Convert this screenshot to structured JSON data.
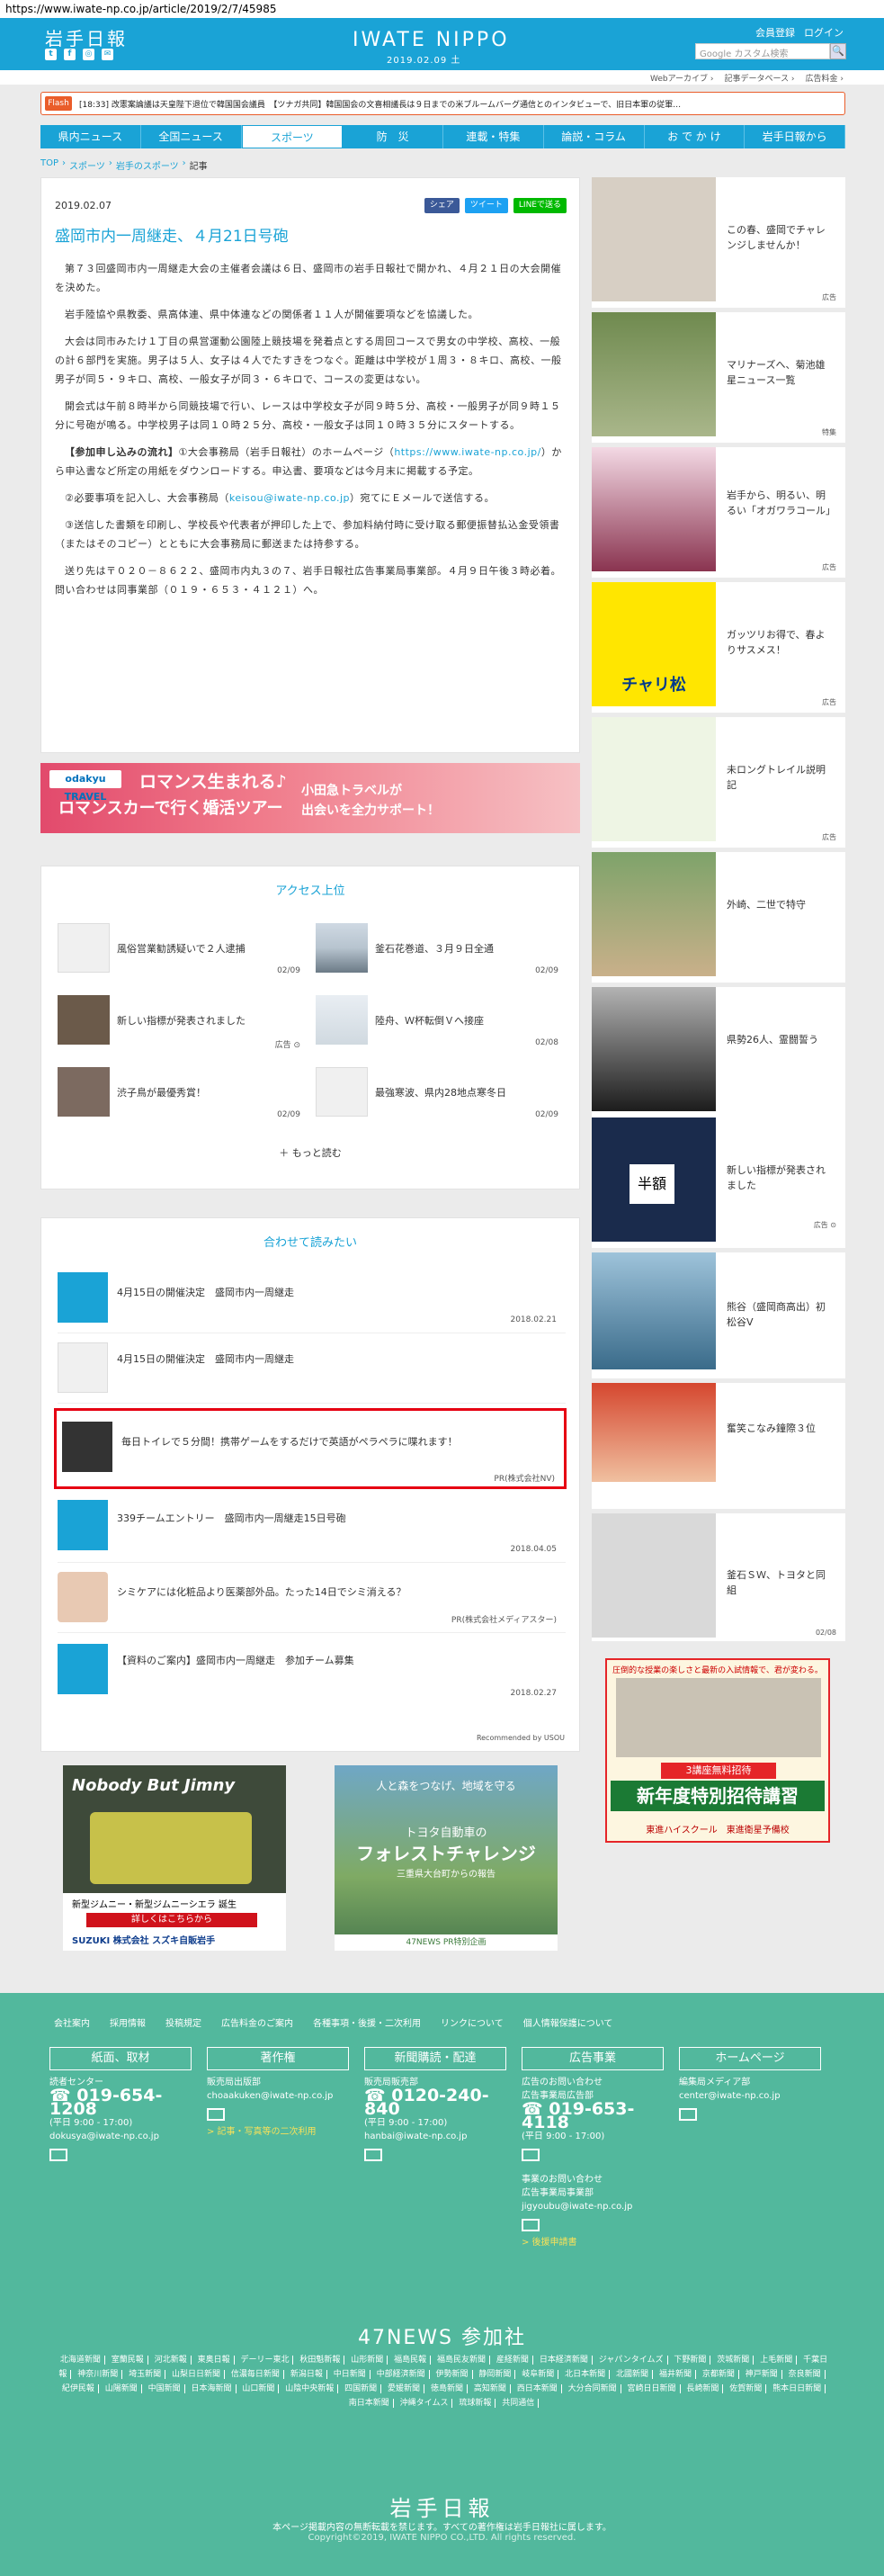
{
  "url": "https://www.iwate-np.co.jp/article/2019/2/7/45985",
  "header": {
    "logo_jp": "岩手日報",
    "logo_en": "IWATE NIPPO",
    "date": "2019.02.09 土",
    "member_register": "会員登録",
    "login": "ログイン",
    "search_placeholder": "Google カスタム検索",
    "search_button": "🔍",
    "social": [
      "twitter-icon",
      "facebook-icon",
      "instagram-icon",
      "mail-icon"
    ]
  },
  "subnav": [
    "Webアーカイブ ›",
    "記事データベース ›",
    "広告料金 ›"
  ],
  "flash": {
    "label": "Flash",
    "text": "[18:33] 改憲案論議は天皇陛下退位で韓国国会議員　【ツナガ共同】韓国国会の文喜相議長は９日までの米ブルームバーグ通信とのインタビューで、旧日本軍の従軍…"
  },
  "gnav": [
    "県内ニュース",
    "全国ニュース",
    "スポーツ",
    "防　災",
    "連載・特集",
    "論説・コラム",
    "お で か け",
    "岩手日報から"
  ],
  "gnav_active": 2,
  "breadcrumb": [
    "TOP",
    "スポーツ",
    "岩手のスポーツ",
    "記事"
  ],
  "article": {
    "date": "2019.02.07",
    "title": "盛岡市内一周継走、４月21日号砲",
    "share_facebook": "シェア",
    "share_twitter": "ツイート",
    "share_line": "LINEで送る",
    "p1": "第７３回盛岡市内一周継走大会の主催者会議は６日、盛岡市の岩手日報社で開かれ、４月２１日の大会開催を決めた。",
    "p2": "岩手陸協や県教委、県高体連、県中体連などの関係者１１人が開催要項などを協議した。",
    "p3": "大会は同市みたけ１丁目の県営運動公園陸上競技場を発着点とする周回コースで男女の中学校、高校、一般の計６部門を実施。男子は５人、女子は４人でたすきをつなぐ。距離は中学校が１周３・８キロ、高校、一般男子が同５・９キロ、高校、一般女子が同３・６キロで、コースの変更はない。",
    "p4": "開会式は午前８時半から同競技場で行い、レースは中学校女子が同９時５分、高校・一般男子が同９時１５分に号砲が鳴る。中学校男子は同１０時２５分、高校・一般女子は同１０時３５分にスタートする。",
    "p5_label": "【参加申し込みの流れ】",
    "p5_text": "①大会事務局（岩手日報社）のホームページ（",
    "p5_url": "https://www.iwate-np.co.jp/",
    "p5_rest": "）から申込書など所定の用紙をダウンロードする。申込書、要項などは今月末に掲載する予定。",
    "p6_pre": "②必要事項を記入し、大会事務局（",
    "p6_mail": "keisou@iwate-np.co.jp",
    "p6_post": "）宛てにＥメールで送信する。",
    "p7": "③送信した書類を印刷し、学校長や代表者が押印した上で、参加料納付時に受け取る郵便振替払込金受領書（またはそのコピー）とともに大会事務局に郵送または持参する。",
    "p8": "送り先は〒０２０－８６２２、盛岡市内丸３の７、岩手日報社広告事業局事業部。４月９日午後３時必着。問い合わせは同事業部（０１９・６５３・４１２１）へ。"
  },
  "ad_odakyu": {
    "brand": "odakyu TRAVEL",
    "line1": "ロマンス生まれる♪",
    "line2": "ロマンスカーで行く婚活ツアー",
    "line3": "小田急トラベルが\n出会いを全力サポート！"
  },
  "access": {
    "title": "アクセス上位",
    "items": [
      {
        "text": "風俗営業勧誘疑いで２人逮捕",
        "date": "02/09"
      },
      {
        "text": "釜石花巻道、３月９日全通",
        "date": "02/09"
      },
      {
        "text": "新しい指標が発表されました",
        "date": "広告 ⊙"
      },
      {
        "text": "陸舟、Ｗ杯転倒Ｖへ接座",
        "date": "02/08"
      },
      {
        "text": "渋子鳥が最優秀賞！",
        "date": "02/09"
      },
      {
        "text": "最強寒波、県内28地点寒冬日",
        "date": "02/09"
      }
    ],
    "more": "もっと読む"
  },
  "related": {
    "title": "合わせて読みたい",
    "items": [
      {
        "text": "4月15日の開催決定　盛岡市内一周継走",
        "meta": "2018.02.21"
      },
      {
        "text": "4月15日の開催決定　盛岡市内一周継走",
        "meta": ""
      },
      {
        "text": "毎日トイレで５分間！携帯ゲームをするだけで英語がペラペラに喋れます！",
        "meta": "PR(株式会社NV)"
      },
      {
        "text": "339チームエントリー　盛岡市内一周継走15日号砲",
        "meta": "2018.04.05"
      },
      {
        "text": "シミケアには化粧品より医薬部外品。たった14日でシミ消える？",
        "meta": "PR(株式会社メディアスター)"
      },
      {
        "text": "【資料のご案内】盛岡市内一周継走　参加チーム募集",
        "meta": "2018.02.27"
      }
    ],
    "recommended": "Recommended by USOU"
  },
  "side": [
    {
      "text": "この春、盛岡でチャレンジしませんか！",
      "note": "広告"
    },
    {
      "text": "マリナーズへ、菊池雄星ニュース一覧",
      "note": "特集"
    },
    {
      "text": "岩手から、明るい、明るい「オガワラコール」",
      "note": "広告"
    },
    {
      "text": "ガッツリお得で、春よりサスメス！",
      "note": "広告"
    },
    {
      "text": "未ロングトレイル説明記",
      "note": "広告"
    },
    {
      "text": "外崎、二世で特守",
      "note": ""
    },
    {
      "text": "県勢26人、霊闘誓う",
      "note": ""
    },
    {
      "text": "新しい指標が発表されました",
      "note": "広告 ⊙"
    },
    {
      "text": "熊谷（盛岡商高出）初松谷V",
      "note": ""
    },
    {
      "text": "奮笑こなみ鐘際３位",
      "note": ""
    },
    {
      "text": "釜石ＳＷ、トヨタと同組",
      "note": "02/08"
    }
  ],
  "side_ad_cycle": "チャリ松",
  "ad_jimny": {
    "title": "Nobody But Jimny",
    "sub": "新型ジムニー・新型ジムニーシエラ 誕生",
    "cta": "詳しくはこちらから",
    "maker": "SUZUKI 株式会社 スズキ自販岩手"
  },
  "ad_toyota": {
    "line1": "人と森をつなげ、地域を守る",
    "line2": "トヨタ自動車の",
    "line3": "フォレストチャレンジ",
    "line4": "三重県大台町からの報告",
    "footer": "47NEWS PR特別企画"
  },
  "ad_school": {
    "top": "圧倒的な授業の楽しさと最新の入試情報で、君が変わる。",
    "badge": "3講座無料招待",
    "title": "新年度特別招待講習",
    "sub": "東進ハイスクール　東進衛星予備校"
  },
  "footer": {
    "links": [
      "会社案内",
      "採用情報",
      "投稿規定",
      "広告料金のご案内",
      "各種事項・後援・二次利用",
      "リンクについて",
      "個人情報保護について"
    ],
    "cols": [
      {
        "head": "紙面、取材",
        "l1": "読者センター",
        "tel": "019-654-1208",
        "hours": "(平日 9:00 - 17:00)",
        "mail": "dokusya@iwate-np.co.jp",
        "extra": ""
      },
      {
        "head": "著作権",
        "l1": "販売局出版部",
        "tel": "",
        "hours": "",
        "mail": "choaakuken@iwate-np.co.jp",
        "extra": "> 記事・写真等の二次利用"
      },
      {
        "head": "新聞購読・配達",
        "l1": "販売局販売部",
        "tel": "0120-240-840",
        "hours": "(平日 9:00 - 17:00)",
        "mail": "hanbai@iwate-np.co.jp",
        "extra": ""
      },
      {
        "head": "広告事業",
        "l1": "広告のお問い合わせ\n広告事業局広告部",
        "tel": "019-653-4118",
        "hours": "(平日 9:00 - 17:00)",
        "mail": "jigyoubu@iwate-np.co.jp",
        "extra": "> 後援申請書"
      },
      {
        "head": "ホームページ",
        "l1": "編集局メディア部",
        "tel": "",
        "hours": "",
        "mail": "center@iwate-np.co.jp",
        "extra": ""
      }
    ],
    "col4_extra_label": "事業のお問い合わせ\n広告事業局事業部",
    "n47_title": "47NEWS 参加社",
    "n47": [
      "北海道新聞",
      "室蘭民報",
      "河北新報",
      "東奥日報",
      "デーリー東北",
      "秋田魁新報",
      "山形新聞",
      "福島民報",
      "福島民友新聞",
      "産経新聞",
      "日本経済新聞",
      "ジャパンタイムズ",
      "下野新聞",
      "茨城新聞",
      "上毛新聞",
      "千葉日報",
      "神奈川新聞",
      "埼玉新聞",
      "山梨日日新聞",
      "信濃毎日新聞",
      "新潟日報",
      "中日新聞",
      "中部経済新聞",
      "伊勢新聞",
      "静岡新聞",
      "岐阜新聞",
      "北日本新聞",
      "北國新聞",
      "福井新聞",
      "京都新聞",
      "神戸新聞",
      "奈良新聞",
      "紀伊民報",
      "山陽新聞",
      "中国新聞",
      "日本海新聞",
      "山口新聞",
      "山陰中央新報",
      "四国新聞",
      "愛媛新聞",
      "徳島新聞",
      "高知新聞",
      "西日本新聞",
      "大分合同新聞",
      "宮崎日日新聞",
      "長崎新聞",
      "佐賀新聞",
      "熊本日日新聞",
      "南日本新聞",
      "沖縄タイムス",
      "琉球新報",
      "共同通信"
    ],
    "logo": "岩手日報",
    "note": "本ページ掲載内容の無断転載を禁じます。すべての著作権は岩手日報社に属します。",
    "copyright": "Copyright©2019, IWATE NIPPO CO.,LTD. All rights reserved."
  }
}
